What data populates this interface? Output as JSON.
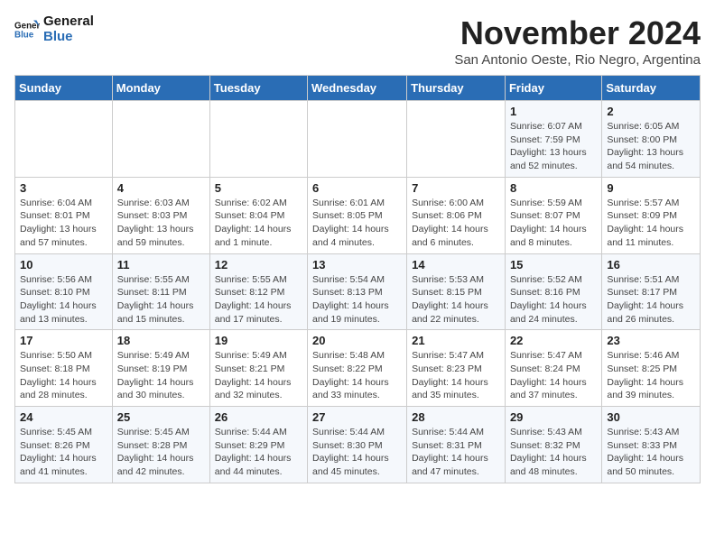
{
  "logo": {
    "text_general": "General",
    "text_blue": "Blue"
  },
  "header": {
    "title": "November 2024",
    "subtitle": "San Antonio Oeste, Rio Negro, Argentina"
  },
  "weekdays": [
    "Sunday",
    "Monday",
    "Tuesday",
    "Wednesday",
    "Thursday",
    "Friday",
    "Saturday"
  ],
  "weeks": [
    [
      {
        "day": "",
        "info": ""
      },
      {
        "day": "",
        "info": ""
      },
      {
        "day": "",
        "info": ""
      },
      {
        "day": "",
        "info": ""
      },
      {
        "day": "",
        "info": ""
      },
      {
        "day": "1",
        "info": "Sunrise: 6:07 AM\nSunset: 7:59 PM\nDaylight: 13 hours and 52 minutes."
      },
      {
        "day": "2",
        "info": "Sunrise: 6:05 AM\nSunset: 8:00 PM\nDaylight: 13 hours and 54 minutes."
      }
    ],
    [
      {
        "day": "3",
        "info": "Sunrise: 6:04 AM\nSunset: 8:01 PM\nDaylight: 13 hours and 57 minutes."
      },
      {
        "day": "4",
        "info": "Sunrise: 6:03 AM\nSunset: 8:03 PM\nDaylight: 13 hours and 59 minutes."
      },
      {
        "day": "5",
        "info": "Sunrise: 6:02 AM\nSunset: 8:04 PM\nDaylight: 14 hours and 1 minute."
      },
      {
        "day": "6",
        "info": "Sunrise: 6:01 AM\nSunset: 8:05 PM\nDaylight: 14 hours and 4 minutes."
      },
      {
        "day": "7",
        "info": "Sunrise: 6:00 AM\nSunset: 8:06 PM\nDaylight: 14 hours and 6 minutes."
      },
      {
        "day": "8",
        "info": "Sunrise: 5:59 AM\nSunset: 8:07 PM\nDaylight: 14 hours and 8 minutes."
      },
      {
        "day": "9",
        "info": "Sunrise: 5:57 AM\nSunset: 8:09 PM\nDaylight: 14 hours and 11 minutes."
      }
    ],
    [
      {
        "day": "10",
        "info": "Sunrise: 5:56 AM\nSunset: 8:10 PM\nDaylight: 14 hours and 13 minutes."
      },
      {
        "day": "11",
        "info": "Sunrise: 5:55 AM\nSunset: 8:11 PM\nDaylight: 14 hours and 15 minutes."
      },
      {
        "day": "12",
        "info": "Sunrise: 5:55 AM\nSunset: 8:12 PM\nDaylight: 14 hours and 17 minutes."
      },
      {
        "day": "13",
        "info": "Sunrise: 5:54 AM\nSunset: 8:13 PM\nDaylight: 14 hours and 19 minutes."
      },
      {
        "day": "14",
        "info": "Sunrise: 5:53 AM\nSunset: 8:15 PM\nDaylight: 14 hours and 22 minutes."
      },
      {
        "day": "15",
        "info": "Sunrise: 5:52 AM\nSunset: 8:16 PM\nDaylight: 14 hours and 24 minutes."
      },
      {
        "day": "16",
        "info": "Sunrise: 5:51 AM\nSunset: 8:17 PM\nDaylight: 14 hours and 26 minutes."
      }
    ],
    [
      {
        "day": "17",
        "info": "Sunrise: 5:50 AM\nSunset: 8:18 PM\nDaylight: 14 hours and 28 minutes."
      },
      {
        "day": "18",
        "info": "Sunrise: 5:49 AM\nSunset: 8:19 PM\nDaylight: 14 hours and 30 minutes."
      },
      {
        "day": "19",
        "info": "Sunrise: 5:49 AM\nSunset: 8:21 PM\nDaylight: 14 hours and 32 minutes."
      },
      {
        "day": "20",
        "info": "Sunrise: 5:48 AM\nSunset: 8:22 PM\nDaylight: 14 hours and 33 minutes."
      },
      {
        "day": "21",
        "info": "Sunrise: 5:47 AM\nSunset: 8:23 PM\nDaylight: 14 hours and 35 minutes."
      },
      {
        "day": "22",
        "info": "Sunrise: 5:47 AM\nSunset: 8:24 PM\nDaylight: 14 hours and 37 minutes."
      },
      {
        "day": "23",
        "info": "Sunrise: 5:46 AM\nSunset: 8:25 PM\nDaylight: 14 hours and 39 minutes."
      }
    ],
    [
      {
        "day": "24",
        "info": "Sunrise: 5:45 AM\nSunset: 8:26 PM\nDaylight: 14 hours and 41 minutes."
      },
      {
        "day": "25",
        "info": "Sunrise: 5:45 AM\nSunset: 8:28 PM\nDaylight: 14 hours and 42 minutes."
      },
      {
        "day": "26",
        "info": "Sunrise: 5:44 AM\nSunset: 8:29 PM\nDaylight: 14 hours and 44 minutes."
      },
      {
        "day": "27",
        "info": "Sunrise: 5:44 AM\nSunset: 8:30 PM\nDaylight: 14 hours and 45 minutes."
      },
      {
        "day": "28",
        "info": "Sunrise: 5:44 AM\nSunset: 8:31 PM\nDaylight: 14 hours and 47 minutes."
      },
      {
        "day": "29",
        "info": "Sunrise: 5:43 AM\nSunset: 8:32 PM\nDaylight: 14 hours and 48 minutes."
      },
      {
        "day": "30",
        "info": "Sunrise: 5:43 AM\nSunset: 8:33 PM\nDaylight: 14 hours and 50 minutes."
      }
    ]
  ]
}
